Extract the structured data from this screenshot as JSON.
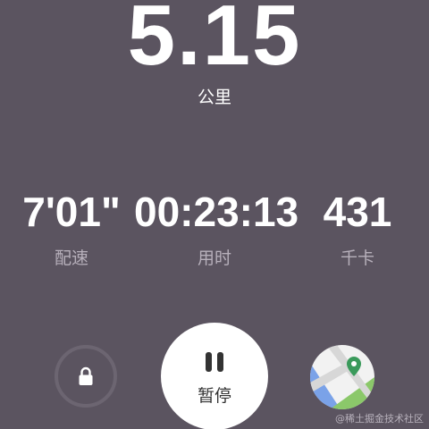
{
  "distance": {
    "value": "5.15",
    "unit": "公里"
  },
  "metrics": {
    "pace": {
      "value": "7'01\"",
      "label": "配速"
    },
    "duration": {
      "value": "00:23:13",
      "label": "用时"
    },
    "calories": {
      "value": "431",
      "label": "千卡"
    }
  },
  "controls": {
    "pause_label": "暂停",
    "lock_icon": "lock-icon",
    "pause_icon": "pause-icon",
    "map_icon": "map-pin-icon"
  },
  "watermark": "@稀土掘金技术社区",
  "colors": {
    "background": "#5b5460",
    "label_gray": "#b7b0bb",
    "ring": "#6c6571",
    "map_pin": "#3a9a5b",
    "map_water": "#7aa2e8",
    "map_park": "#8bc86a"
  }
}
